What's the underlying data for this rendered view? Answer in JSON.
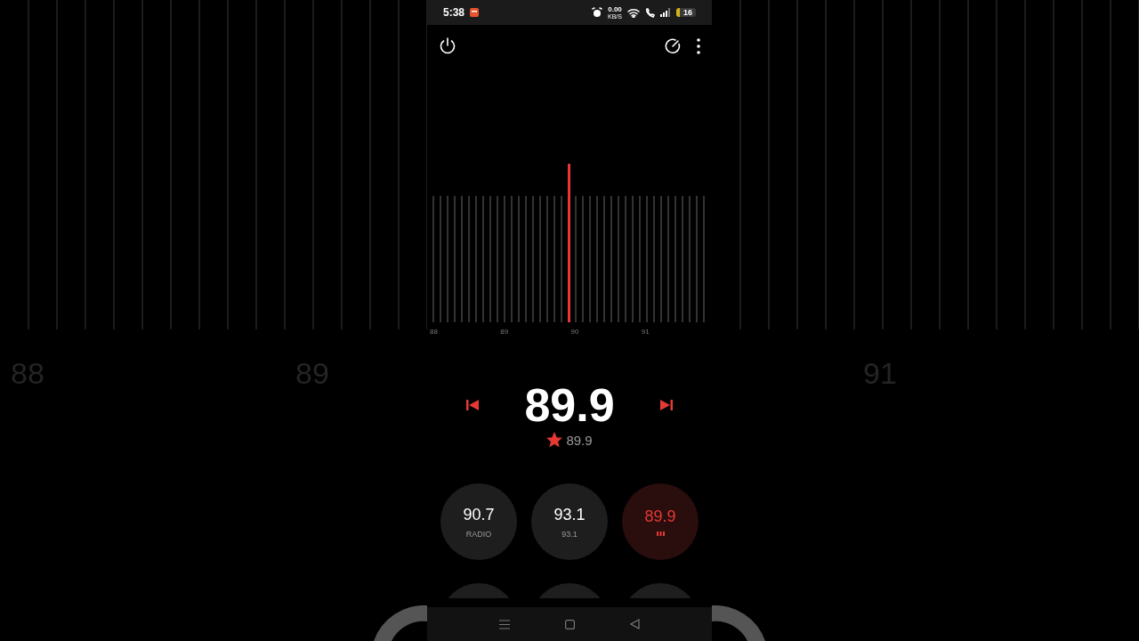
{
  "status_bar": {
    "time": "5:38",
    "net_speed": "0.00",
    "net_unit": "KB/S",
    "battery": "16"
  },
  "backdrop": {
    "left_labels": [
      "88",
      "89"
    ],
    "right_labels": [
      "91"
    ]
  },
  "dial": {
    "labels": [
      "88",
      "89",
      "90",
      "91"
    ]
  },
  "station": {
    "frequency": "89.9",
    "favorite": true,
    "name": "89.9"
  },
  "presets": [
    {
      "kind": "station",
      "frequency": "90.7",
      "name": "RADIO",
      "selected": false
    },
    {
      "kind": "station",
      "frequency": "93.1",
      "name": "93.1",
      "selected": false
    },
    {
      "kind": "station",
      "frequency": "89.9",
      "selected": true
    },
    {
      "kind": "covered",
      "selected": false
    },
    {
      "kind": "covered",
      "selected": false
    },
    {
      "kind": "covered",
      "selected": false
    }
  ]
}
